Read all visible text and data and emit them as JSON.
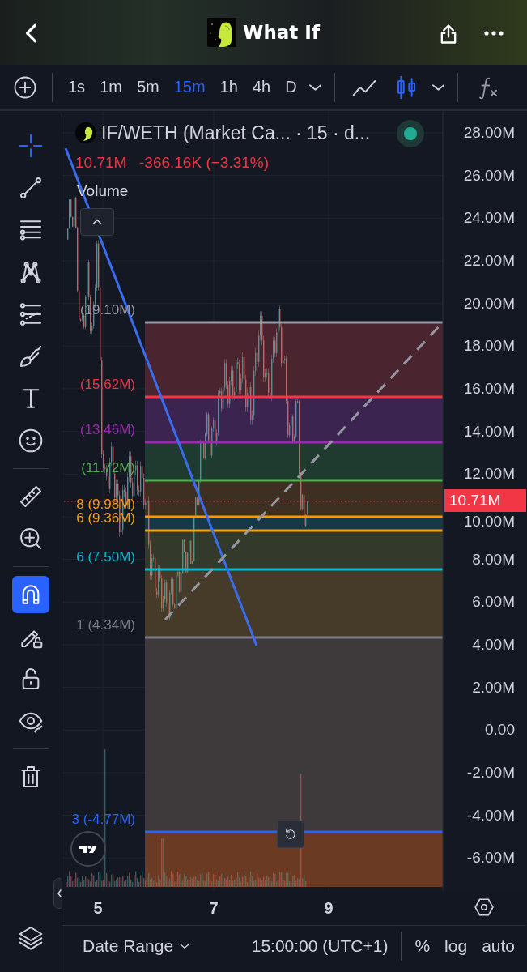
{
  "header": {
    "title": "What If"
  },
  "toolbar": {
    "intervals": [
      {
        "label": "1s",
        "selected": false
      },
      {
        "label": "1m",
        "selected": false
      },
      {
        "label": "5m",
        "selected": false
      },
      {
        "label": "15m",
        "selected": true
      },
      {
        "label": "1h",
        "selected": false
      },
      {
        "label": "4h",
        "selected": false
      },
      {
        "label": "D",
        "selected": false
      }
    ],
    "chart_types": [
      {
        "kind": "line",
        "selected": false
      },
      {
        "kind": "candles",
        "selected": true
      }
    ]
  },
  "tools": [
    {
      "kind": "crosshair",
      "on": true
    },
    {
      "kind": "trend-line",
      "on": false
    },
    {
      "kind": "lines",
      "on": false
    },
    {
      "kind": "nodes",
      "on": false
    },
    {
      "kind": "dotted-lines",
      "on": false
    },
    {
      "kind": "brush",
      "on": false
    },
    {
      "kind": "text",
      "on": false
    },
    {
      "kind": "smiley",
      "on": false
    },
    {
      "kind": "ruler",
      "on": false
    },
    {
      "kind": "zoom",
      "on": false
    },
    {
      "kind": "magnet",
      "on": true
    },
    {
      "kind": "pencil-lock",
      "on": false
    },
    {
      "kind": "lock",
      "on": false
    },
    {
      "kind": "eye",
      "on": false
    },
    {
      "kind": "trash",
      "on": false
    }
  ],
  "legend": {
    "symbol": "IF/WETH (Market Ca...",
    "details": "· 15 · d...",
    "price": "10.71M",
    "change": "-366.16K (−3.31%)",
    "volume_label": "Volume"
  },
  "fib_levels": [
    {
      "label": "(19.10M)",
      "color": "#9598a1"
    },
    {
      "label": "(15.62M)",
      "color": "#f23645"
    },
    {
      "label": "(13.46M)",
      "color": "#9c27b0"
    },
    {
      "label": "(11.72M)",
      "color": "#4caf50"
    },
    {
      "label": "8 (9.98M)",
      "color": "#ff9800"
    },
    {
      "label": "6 (9.36M)",
      "color": "#ffa000"
    },
    {
      "label": "6 (7.50M)",
      "color": "#00bcd4"
    },
    {
      "label": "1 (4.34M)",
      "color": "#787b86"
    },
    {
      "label": "3 (-4.77M)",
      "color": "#2962ff"
    }
  ],
  "price_axis": {
    "labels": [
      "28.00M",
      "26.00M",
      "24.00M",
      "22.00M",
      "20.00M",
      "18.00M",
      "16.00M",
      "14.00M",
      "12.00M",
      "10.00M",
      "8.00M",
      "6.00M",
      "4.00M",
      "2.00M",
      "0.00",
      "-2.00M",
      "-4.00M",
      "-6.00M"
    ],
    "current_price": "10.71M"
  },
  "time_axis": [
    "5",
    "7",
    "9"
  ],
  "bottom_bar": {
    "date_range": "Date Range",
    "time": "15:00:00 (UTC+1)",
    "percent": "%",
    "log": "log",
    "auto": "auto"
  }
}
